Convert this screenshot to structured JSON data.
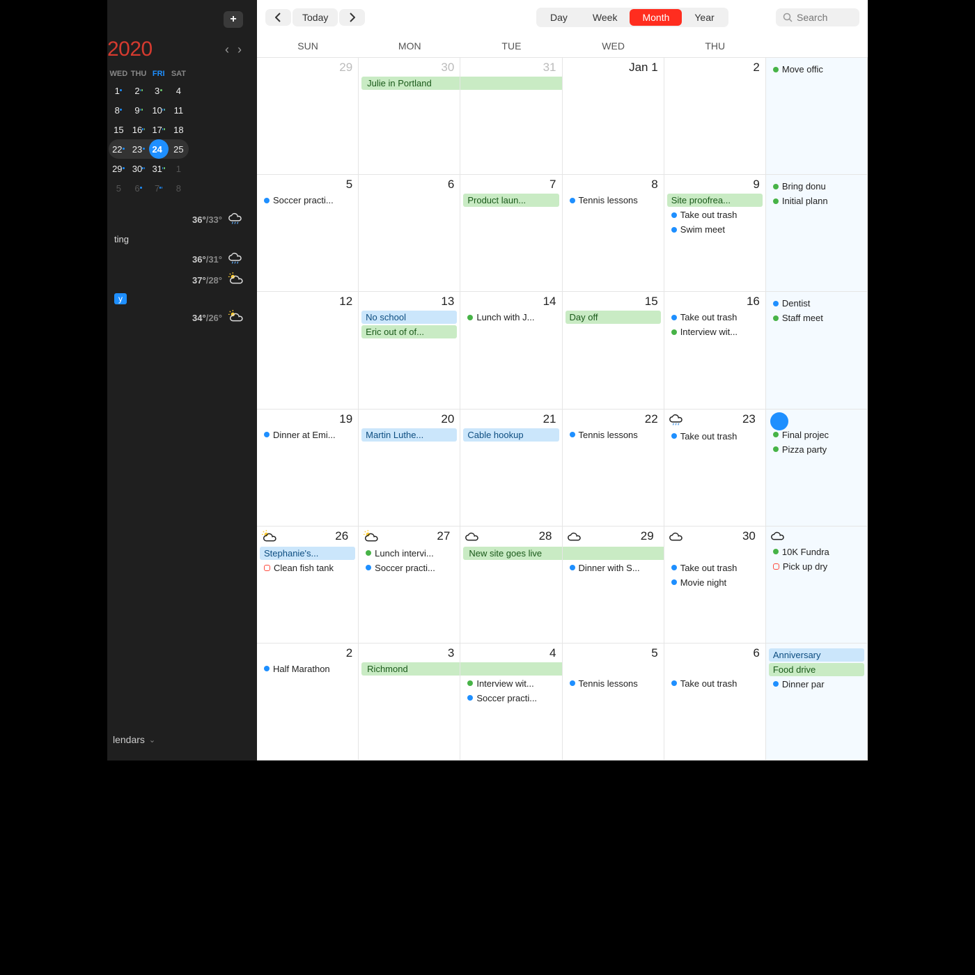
{
  "sidebar": {
    "year": "2020",
    "mini_headers": [
      "WED",
      "THU",
      "FRI",
      "SAT"
    ],
    "mini_rows": [
      [
        {
          "n": "1",
          "d": [
            "b"
          ]
        },
        {
          "n": "2",
          "d": [
            "b",
            "g"
          ]
        },
        {
          "n": "3",
          "d": [
            "g"
          ]
        },
        {
          "n": "4"
        }
      ],
      [
        {
          "n": "8",
          "d": [
            "b"
          ]
        },
        {
          "n": "9",
          "d": [
            "b",
            "g"
          ]
        },
        {
          "n": "10",
          "d": [
            "b",
            "b",
            "g"
          ]
        },
        {
          "n": "11"
        }
      ],
      [
        {
          "n": "15"
        },
        {
          "n": "16",
          "d": [
            "b",
            "g"
          ]
        },
        {
          "n": "17",
          "d": [
            "b",
            "g"
          ]
        },
        {
          "n": "18"
        }
      ],
      [
        {
          "n": "22",
          "hl": true,
          "d": [
            "b"
          ]
        },
        {
          "n": "23",
          "hl": true,
          "d": [
            "b"
          ]
        },
        {
          "n": "24",
          "hl": true,
          "sel": true,
          "d": [
            "b",
            "b"
          ]
        },
        {
          "n": "25",
          "hl": true
        }
      ],
      [
        {
          "n": "29",
          "d": [
            "b"
          ]
        },
        {
          "n": "30",
          "d": [
            "b",
            "b"
          ]
        },
        {
          "n": "31",
          "d": [
            "b",
            "g"
          ]
        },
        {
          "n": "1",
          "dim": true
        }
      ],
      [
        {
          "n": "5",
          "dim": true
        },
        {
          "n": "6",
          "dim": true,
          "d": [
            "b"
          ]
        },
        {
          "n": "7",
          "dim": true,
          "d": [
            "b",
            "b"
          ]
        },
        {
          "n": "8",
          "dim": true
        }
      ]
    ],
    "agenda": [
      {
        "kind": "weather",
        "hi": "36°",
        "lo": "/33°",
        "icon": "cloud-rain"
      },
      {
        "kind": "text",
        "text": "ting"
      },
      {
        "kind": "weather",
        "hi": "36°",
        "lo": "/31°",
        "icon": "cloud-rain"
      },
      {
        "kind": "weather",
        "hi": "37°",
        "lo": "/28°",
        "icon": "cloud-sun"
      },
      {
        "kind": "pill",
        "text": "y"
      },
      {
        "kind": "weather",
        "hi": "34°",
        "lo": "/26°",
        "icon": "cloud-sun"
      }
    ],
    "calendars_label": "lendars"
  },
  "toolbar": {
    "today": "Today",
    "views": [
      "Day",
      "Week",
      "Month",
      "Year"
    ],
    "active_view": "Month",
    "search_placeholder": "Search"
  },
  "day_headers": [
    "SUN",
    "MON",
    "TUE",
    "WED",
    "THU",
    ""
  ],
  "weeks": [
    {
      "cells": [
        {
          "num": "29",
          "dim": true,
          "events": []
        },
        {
          "num": "30",
          "dim": true,
          "events": [
            {
              "t": "Julie in Portland",
              "c": "g",
              "span": "first"
            }
          ]
        },
        {
          "num": "31",
          "dim": true,
          "events": [
            {
              "t": "",
              "c": "g",
              "span": "mid"
            }
          ]
        },
        {
          "num": "Jan 1",
          "first": true,
          "events": [
            {
              "t": "",
              "c": "g",
              "span": "mid",
              "blank": true
            }
          ]
        },
        {
          "num": "2",
          "events": []
        },
        {
          "num": "",
          "today": true,
          "events": [
            {
              "t": "Move offic",
              "c": "plain",
              "dot": "g"
            }
          ]
        }
      ]
    },
    {
      "cells": [
        {
          "num": "5",
          "events": [
            {
              "t": "Soccer practi...",
              "c": "plain",
              "dot": "b"
            }
          ]
        },
        {
          "num": "6",
          "events": []
        },
        {
          "num": "7",
          "events": [
            {
              "t": "Product laun...",
              "c": "g"
            }
          ]
        },
        {
          "num": "8",
          "events": [
            {
              "t": "Tennis lessons",
              "c": "plain",
              "dot": "b"
            }
          ]
        },
        {
          "num": "9",
          "events": [
            {
              "t": "Site proofrea...",
              "c": "g"
            },
            {
              "t": "Take out trash",
              "c": "plain",
              "dot": "b"
            },
            {
              "t": "Swim meet",
              "c": "plain",
              "dot": "b"
            }
          ]
        },
        {
          "num": "",
          "today": true,
          "events": [
            {
              "t": "Bring donu",
              "c": "plain",
              "dot": "g"
            },
            {
              "t": "Initial plann",
              "c": "plain",
              "dot": "g"
            }
          ]
        }
      ]
    },
    {
      "cells": [
        {
          "num": "12",
          "events": []
        },
        {
          "num": "13",
          "events": [
            {
              "t": "No school",
              "c": "b"
            },
            {
              "t": "Eric out of of...",
              "c": "g"
            }
          ]
        },
        {
          "num": "14",
          "events": [
            {
              "t": "Lunch with J...",
              "c": "plain",
              "dot": "g"
            }
          ]
        },
        {
          "num": "15",
          "events": [
            {
              "t": "Day off",
              "c": "g"
            }
          ]
        },
        {
          "num": "16",
          "events": [
            {
              "t": "Take out trash",
              "c": "plain",
              "dot": "b"
            },
            {
              "t": "Interview wit...",
              "c": "plain",
              "dot": "g"
            }
          ]
        },
        {
          "num": "",
          "today": true,
          "events": [
            {
              "t": "Dentist",
              "c": "plain",
              "dot": "b"
            },
            {
              "t": "Staff meet",
              "c": "plain",
              "dot": "g"
            }
          ]
        }
      ]
    },
    {
      "cells": [
        {
          "num": "19",
          "events": [
            {
              "t": "Dinner at Emi...",
              "c": "plain",
              "dot": "b"
            }
          ]
        },
        {
          "num": "20",
          "events": [
            {
              "t": "Martin Luthe...",
              "c": "b"
            }
          ]
        },
        {
          "num": "21",
          "events": [
            {
              "t": "Cable hookup",
              "c": "b"
            }
          ]
        },
        {
          "num": "22",
          "events": [
            {
              "t": "Tennis lessons",
              "c": "plain",
              "dot": "b"
            }
          ]
        },
        {
          "num": "23",
          "weather": "cloud-rain",
          "events": [
            {
              "t": "Take out trash",
              "c": "plain",
              "dot": "b"
            }
          ]
        },
        {
          "num": "",
          "today": true,
          "weather": "today-circle",
          "events": [
            {
              "t": "Final projec",
              "c": "plain",
              "dot": "g"
            },
            {
              "t": "Pizza party",
              "c": "plain",
              "dot": "g"
            }
          ]
        }
      ]
    },
    {
      "cells": [
        {
          "num": "26",
          "weather": "cloud-sun",
          "events": [
            {
              "t": "Stephanie's...",
              "c": "b"
            },
            {
              "t": "Clean fish tank",
              "c": "plain",
              "dot": "r"
            }
          ]
        },
        {
          "num": "27",
          "weather": "cloud-sun",
          "events": [
            {
              "t": "Lunch intervi...",
              "c": "plain",
              "dot": "g"
            },
            {
              "t": "Soccer practi...",
              "c": "plain",
              "dot": "b"
            }
          ]
        },
        {
          "num": "28",
          "weather": "cloud",
          "events": [
            {
              "t": "New site goes live",
              "c": "g",
              "span": "first"
            }
          ]
        },
        {
          "num": "29",
          "weather": "cloud",
          "events": [
            {
              "t": "",
              "c": "g",
              "span": "mid"
            },
            {
              "t": "Dinner with S...",
              "c": "plain",
              "dot": "b"
            }
          ]
        },
        {
          "num": "30",
          "weather": "cloud",
          "events": [
            {
              "t": "",
              "c": "g",
              "span": "mid",
              "blank": true
            },
            {
              "t": "Take out trash",
              "c": "plain",
              "dot": "b"
            },
            {
              "t": "Movie night",
              "c": "plain",
              "dot": "b"
            }
          ]
        },
        {
          "num": "",
          "today": true,
          "weather": "cloud",
          "events": [
            {
              "t": "10K Fundra",
              "c": "plain",
              "dot": "g"
            },
            {
              "t": "Pick up dry",
              "c": "plain",
              "dot": "r"
            }
          ]
        }
      ]
    },
    {
      "cells": [
        {
          "num": "2",
          "events": [
            {
              "t": "Half Marathon",
              "c": "plain",
              "dot": "b"
            }
          ]
        },
        {
          "num": "3",
          "events": [
            {
              "t": "Richmond",
              "c": "g",
              "span": "first"
            }
          ]
        },
        {
          "num": "4",
          "events": [
            {
              "t": "",
              "c": "g",
              "span": "mid"
            },
            {
              "t": "Interview wit...",
              "c": "plain",
              "dot": "g"
            },
            {
              "t": "Soccer practi...",
              "c": "plain",
              "dot": "b"
            }
          ]
        },
        {
          "num": "5",
          "events": [
            {
              "t": "",
              "c": "g",
              "span": "mid",
              "blank": true
            },
            {
              "t": "Tennis lessons",
              "c": "plain",
              "dot": "b"
            }
          ]
        },
        {
          "num": "6",
          "events": [
            {
              "t": "",
              "c": "g",
              "span": "mid",
              "blank": true
            },
            {
              "t": "Take out trash",
              "c": "plain",
              "dot": "b"
            }
          ]
        },
        {
          "num": "",
          "today": true,
          "events": [
            {
              "t": "Anniversary",
              "c": "b"
            },
            {
              "t": "Food drive",
              "c": "g"
            },
            {
              "t": "Dinner par",
              "c": "plain",
              "dot": "b"
            }
          ]
        }
      ]
    }
  ]
}
